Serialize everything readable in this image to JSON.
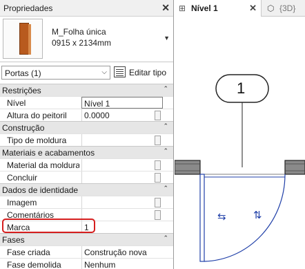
{
  "properties_panel": {
    "title": "Propriedades",
    "close_symbol": "✕",
    "type_selector": {
      "family_name": "M_Folha única",
      "type_name": "0915 x 2134mm",
      "thumbnail_icon": "door-thumbnail-icon"
    },
    "instance_filter": "Portas (1)",
    "edit_type_label": "Editar tipo",
    "categories": [
      {
        "label": "Restrições",
        "rows": [
          {
            "name": "Nível",
            "value": "Nível 1"
          },
          {
            "name": "Altura do peitoril",
            "value": "0.0000"
          }
        ]
      },
      {
        "label": "Construção",
        "rows": [
          {
            "name": "Tipo de moldura",
            "value": ""
          }
        ]
      },
      {
        "label": "Materiais e acabamentos",
        "rows": [
          {
            "name": "Material da moldura",
            "value": ""
          },
          {
            "name": "Concluir",
            "value": ""
          }
        ]
      },
      {
        "label": "Dados de identidade",
        "rows": [
          {
            "name": "Imagem",
            "value": ""
          },
          {
            "name": "Comentários",
            "value": ""
          },
          {
            "name": "Marca",
            "value": "1"
          }
        ]
      },
      {
        "label": "Fases",
        "rows": [
          {
            "name": "Fase criada",
            "value": "Construção nova"
          },
          {
            "name": "Fase demolida",
            "value": "Nenhum"
          }
        ]
      }
    ],
    "highlight_color": "#d51d1d"
  },
  "view_tabs": [
    {
      "label": "Nível 1",
      "icon": "floor-plan-icon",
      "active": true
    },
    {
      "label": "{3D}",
      "icon": "3d-view-icon",
      "active": false
    }
  ],
  "drawing": {
    "door_tag": "1",
    "flip_symbols": [
      "⇆",
      "⇅"
    ],
    "selection_color": "#1f3fa8"
  }
}
